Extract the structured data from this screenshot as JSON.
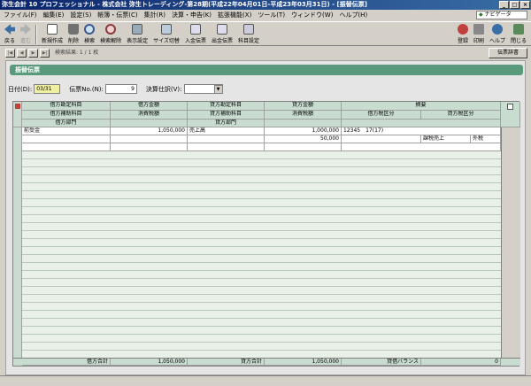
{
  "window": {
    "title": "弥生会計 10 プロフェッショナル - 株式会社 弥生トレーディング-第28期(平成22年04月01日-平成23年03月31日) - [振替伝票]"
  },
  "menu": [
    "ファイル(F)",
    "編集(E)",
    "設定(S)",
    "帳簿・伝票(C)",
    "集計(R)",
    "決算・申告(K)",
    "拡張機能(X)",
    "ツール(T)",
    "ウィンドウ(W)",
    "ヘルプ(H)"
  ],
  "navi": {
    "label": "ナビゲータ"
  },
  "toolbar": {
    "left": [
      {
        "label": "戻る",
        "disabled": false
      },
      {
        "label": "進む",
        "disabled": true
      }
    ],
    "main": [
      "新規作成",
      "削除",
      "検索",
      "検索解除",
      "表示設定",
      "サイズ切替",
      "入金伝票",
      "出金伝票",
      "科目設定"
    ],
    "right": [
      "登録",
      "印刷",
      "ヘルプ",
      "閉じる"
    ]
  },
  "nav": {
    "search_result": "検索結果: 1 / 1 枚",
    "dict": "伝票辞書"
  },
  "panel": {
    "title": "振替伝票",
    "date_label": "日付(D):",
    "date_value": "03/31",
    "slip_label": "伝票No.(N):",
    "slip_value": "9",
    "settle_label": "決算仕訳(V):",
    "settle_value": ""
  },
  "headers": {
    "row1": [
      "借方勘定科目",
      "借方金額",
      "貸方勘定科目",
      "貸方金額",
      "摘要"
    ],
    "row2": [
      "借方補助科目",
      "消費税額",
      "貸方補助科目",
      "消費税額",
      "借方税区分",
      "貸方税区分"
    ],
    "row3": [
      "借方部門",
      "",
      "貸方部門",
      ""
    ]
  },
  "entry": {
    "debit_account": "前受金",
    "debit_amount": "1,050,000",
    "credit_account": "売上高",
    "credit_amount": "1,000,000",
    "memo": "12345　17(17)",
    "credit_tax": "50,000",
    "tax_class": "課税売上",
    "tax_type": "外税"
  },
  "totals": {
    "debit_label": "借方合計",
    "debit_value": "1,050,000",
    "credit_label": "貸方合計",
    "credit_value": "1,050,000",
    "balance_label": "貸借バランス",
    "balance_value": "0"
  }
}
